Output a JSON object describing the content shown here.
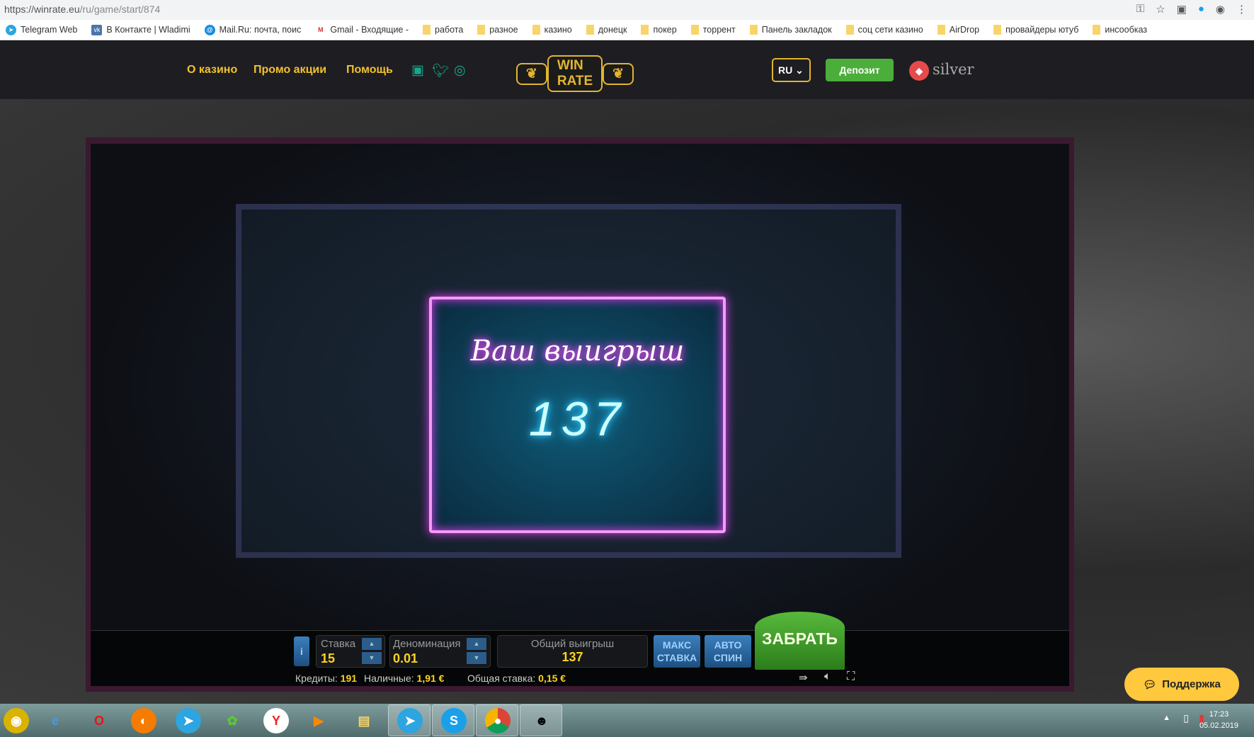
{
  "browser": {
    "url_host": "https://winrate.eu",
    "url_path": "/ru/game/start/874",
    "bookmarks": [
      {
        "label": "Telegram Web",
        "icon": "telegram-icon"
      },
      {
        "label": "В Контакте | Wladimi",
        "icon": "vk-icon"
      },
      {
        "label": "Mail.Ru: почта, поис",
        "icon": "mailru-icon"
      },
      {
        "label": "Gmail - Входящие -",
        "icon": "gmail-icon"
      },
      {
        "label": "работа"
      },
      {
        "label": "разное"
      },
      {
        "label": "казино"
      },
      {
        "label": "донецк"
      },
      {
        "label": "покер"
      },
      {
        "label": "торрент"
      },
      {
        "label": "Панель закладок"
      },
      {
        "label": "соц сети казино"
      },
      {
        "label": "AirDrop"
      },
      {
        "label": "провайдеры ютуб"
      },
      {
        "label": "инсообказ"
      }
    ]
  },
  "site": {
    "nav": [
      "О казино",
      "Промо акции",
      "Помощь"
    ],
    "logo": "WIN RATE",
    "lang": "RU",
    "deposit": "Депозит",
    "level": "silver"
  },
  "game": {
    "win_title": "Ваш выигрыш",
    "win_value": "137",
    "info": "i",
    "bet_label": "Ставка",
    "bet": "15",
    "denom_label": "Деноминация",
    "denom": "0.01",
    "total_label": "Общий выигрыш",
    "total": "137",
    "max_bet": [
      "МАКС",
      "СТАВКА"
    ],
    "auto_spin": [
      "АВТО",
      "СПИН"
    ],
    "take": "ЗАБРАТЬ",
    "credits_label": "Кредиты:",
    "credits": "191",
    "cash_label": "Наличные:",
    "cash": "1,91 €",
    "total_bet_label": "Общая ставка:",
    "total_bet": "0,15 €"
  },
  "support": "Поддержка",
  "clock": {
    "time": "17:23",
    "date": "05.02.2019"
  }
}
